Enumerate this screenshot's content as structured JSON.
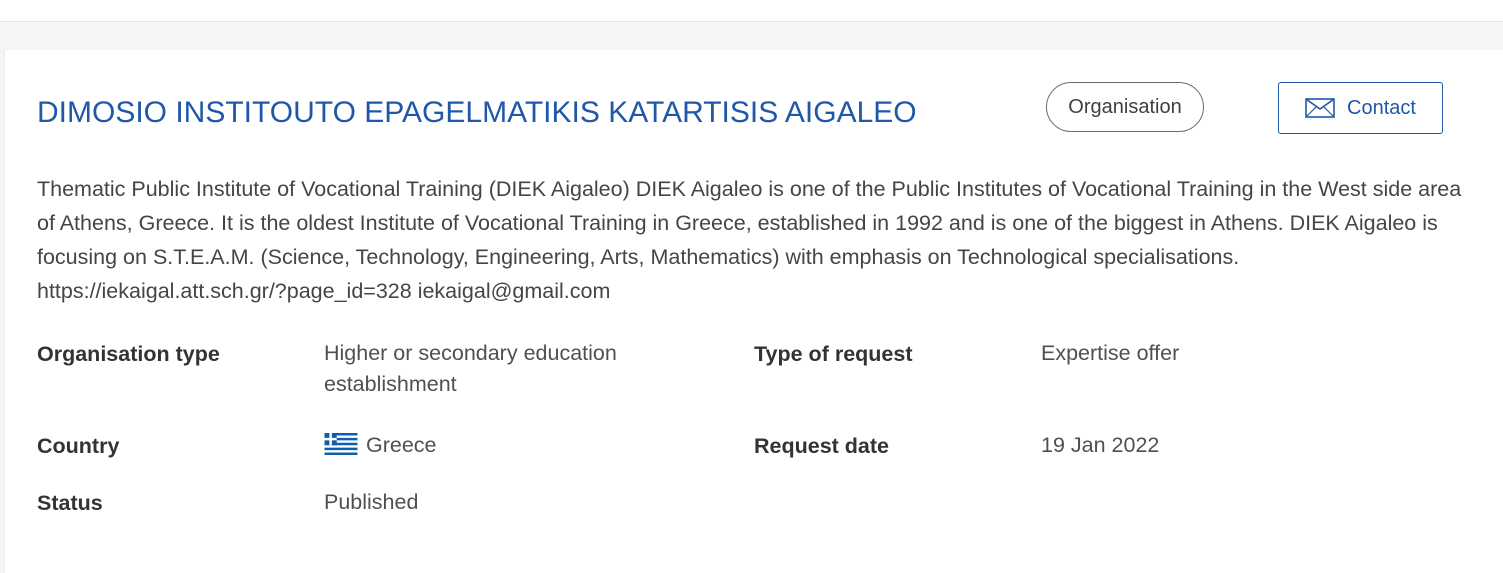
{
  "organisation": {
    "name": "DIMOSIO INSTITOUTO EPAGELMATIKIS KATARTISIS AIGALEO",
    "type_badge": "Organisation",
    "contact_label": "Contact",
    "description": "Thematic Public Institute of Vocational Training (DIEK Aigaleo) DIEK Aigaleo is one of the Public Institutes of Vocational Training in the West side area of Athens, Greece. It is the oldest Institute of Vocational Training in Greece, established in 1992 and is one of the biggest in Athens. DIEK Aigaleo is focusing on S.T.E.A.M. (Science, Technology, Engineering, Arts, Mathematics) with emphasis on Technological specialisations. https://iekaigal.att.sch.gr/?page_id=328 iekaigal@gmail.com"
  },
  "details": {
    "org_type_label": "Organisation type",
    "org_type_value": "Higher or secondary education establishment",
    "request_type_label": "Type of request",
    "request_type_value": "Expertise offer",
    "country_label": "Country",
    "country_value": "Greece",
    "request_date_label": "Request date",
    "request_date_value": "19 Jan 2022",
    "status_label": "Status",
    "status_value": "Published"
  },
  "icons": {
    "contact": "envelope-icon",
    "country_flag": "greece-flag-icon"
  },
  "colors": {
    "accent": "#1f58a8",
    "text": "#404040",
    "flag_blue": "#0d5eaf"
  }
}
